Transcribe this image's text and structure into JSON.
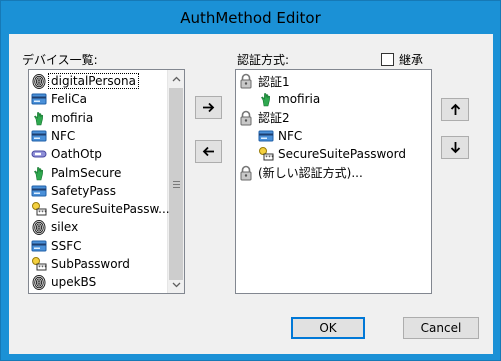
{
  "window": {
    "title": "AuthMethod Editor"
  },
  "devices": {
    "label": "デバイス一覧:",
    "items": [
      {
        "label": "digitalPersona",
        "icon": "fingerprint-icon",
        "selected": true
      },
      {
        "label": "FeliCa",
        "icon": "card-icon"
      },
      {
        "label": "mofiria",
        "icon": "hand-icon"
      },
      {
        "label": "NFC",
        "icon": "card-icon"
      },
      {
        "label": "OathOtp",
        "icon": "token-icon"
      },
      {
        "label": "PalmSecure",
        "icon": "hand-icon"
      },
      {
        "label": "SafetyPass",
        "icon": "card-icon"
      },
      {
        "label": "SecureSuitePassw...",
        "icon": "password-key-icon"
      },
      {
        "label": "silex",
        "icon": "fingerprint-icon"
      },
      {
        "label": "SSFC",
        "icon": "card-icon"
      },
      {
        "label": "SubPassword",
        "icon": "password-key-icon"
      },
      {
        "label": "upekBS",
        "icon": "fingerprint-icon"
      }
    ]
  },
  "methods": {
    "label": "認証方式:",
    "inherit_label": "継承",
    "inherit_checked": false,
    "items": [
      {
        "label": "認証1",
        "icon": "lock-icon",
        "level": 0
      },
      {
        "label": "mofiria",
        "icon": "hand-icon",
        "level": 1
      },
      {
        "label": "認証2",
        "icon": "lock-icon",
        "level": 0
      },
      {
        "label": "NFC",
        "icon": "card-icon",
        "level": 1
      },
      {
        "label": "SecureSuitePassword",
        "icon": "password-key-icon",
        "level": 1
      },
      {
        "label": "(新しい認証方式)...",
        "icon": "lock-icon",
        "level": 0
      }
    ]
  },
  "buttons": {
    "add": "right-arrow-icon",
    "remove": "left-arrow-icon",
    "up": "up-arrow-icon",
    "down": "down-arrow-icon",
    "ok": "OK",
    "cancel": "Cancel"
  }
}
